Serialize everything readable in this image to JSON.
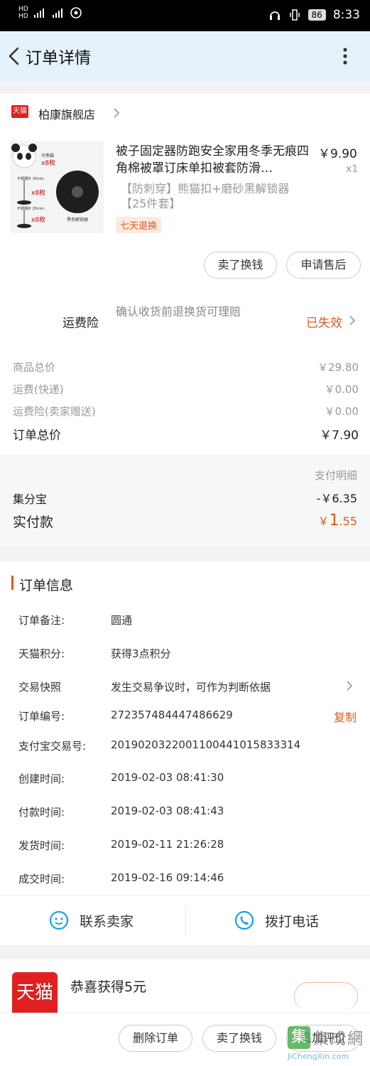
{
  "status_bar": {
    "left_text": "HD 4G 4G",
    "battery": "86",
    "time": "8:33"
  },
  "header": {
    "title": "订单详情"
  },
  "shop": {
    "logo_text": "天猫",
    "name": "柏康旗舰店"
  },
  "product": {
    "title": "被子固定器防跑安全家用冬季无痕四角棉被罩订床单扣被套防滑…",
    "price": "￥9.90",
    "qty": "x1",
    "sku_line1": "【防刺穿】熊猫扣+磨砂黑解锁器",
    "sku_line2": "【25件套】",
    "badge": "七天退换",
    "image_labels": {
      "top": "大熊猫",
      "top_count": "x8枚",
      "mid1": "不锈钢针 30mm",
      "mid1_count": "x8枚",
      "mid2": "不锈钢针 25mm",
      "mid2_count": "x8枚",
      "unlock": "黑色解锁器"
    }
  },
  "actions": {
    "sell": "卖了换钱",
    "after_sale": "申请售后"
  },
  "insurance": {
    "label": "运费险",
    "desc": "确认收货前退换货可理赔",
    "status": "已失效"
  },
  "prices": {
    "goods_label": "商品总价",
    "goods_value": "￥29.80",
    "shipping_label": "运费(快递)",
    "shipping_value": "￥0.00",
    "ins_label": "运费险(卖家赠送)",
    "ins_value": "￥0.00",
    "total_label": "订单总价",
    "total_value": "￥7.90"
  },
  "payment": {
    "detail_link": "支付明细",
    "jifenbao_label": "集分宝",
    "jifenbao_value": "-￥6.35",
    "paid_label": "实付款",
    "paid_currency": "￥",
    "paid_int": "1",
    "paid_dec": ".55"
  },
  "order_info": {
    "section_title": "订单信息",
    "rows": [
      {
        "label": "订单备注:",
        "value": "圆通"
      },
      {
        "label": "天猫积分:",
        "value": "获得3点积分"
      },
      {
        "label": "交易快照",
        "value": "发生交易争议时，可作为判断依据"
      },
      {
        "label": "订单编号:",
        "value": "272357484447486629"
      },
      {
        "label": "支付宝交易号:",
        "value": "2019020322001100441015833314"
      },
      {
        "label": "创建时间:",
        "value": "2019-02-03 08:41:30"
      },
      {
        "label": "付款时间:",
        "value": "2019-02-03 08:41:43"
      },
      {
        "label": "发货时间:",
        "value": "2019-02-11 21:26:28"
      },
      {
        "label": "成交时间:",
        "value": "2019-02-16 09:14:46"
      }
    ],
    "copy_label": "复制"
  },
  "contact": {
    "seller": "联系卖家",
    "phone": "拨打电话"
  },
  "promo": {
    "logo_text": "天猫",
    "text": "恭喜获得5元"
  },
  "footer": {
    "delete": "删除订单",
    "sell": "卖了换钱",
    "review": "追加评价"
  },
  "watermark": {
    "text": "集成網",
    "sub": "JiChengXin.com"
  },
  "colors": {
    "accent": "#e05a1e",
    "header_bg": "#e5f2fb",
    "tmall_red": "#e02020",
    "link_blue": "#1aa0e8"
  }
}
